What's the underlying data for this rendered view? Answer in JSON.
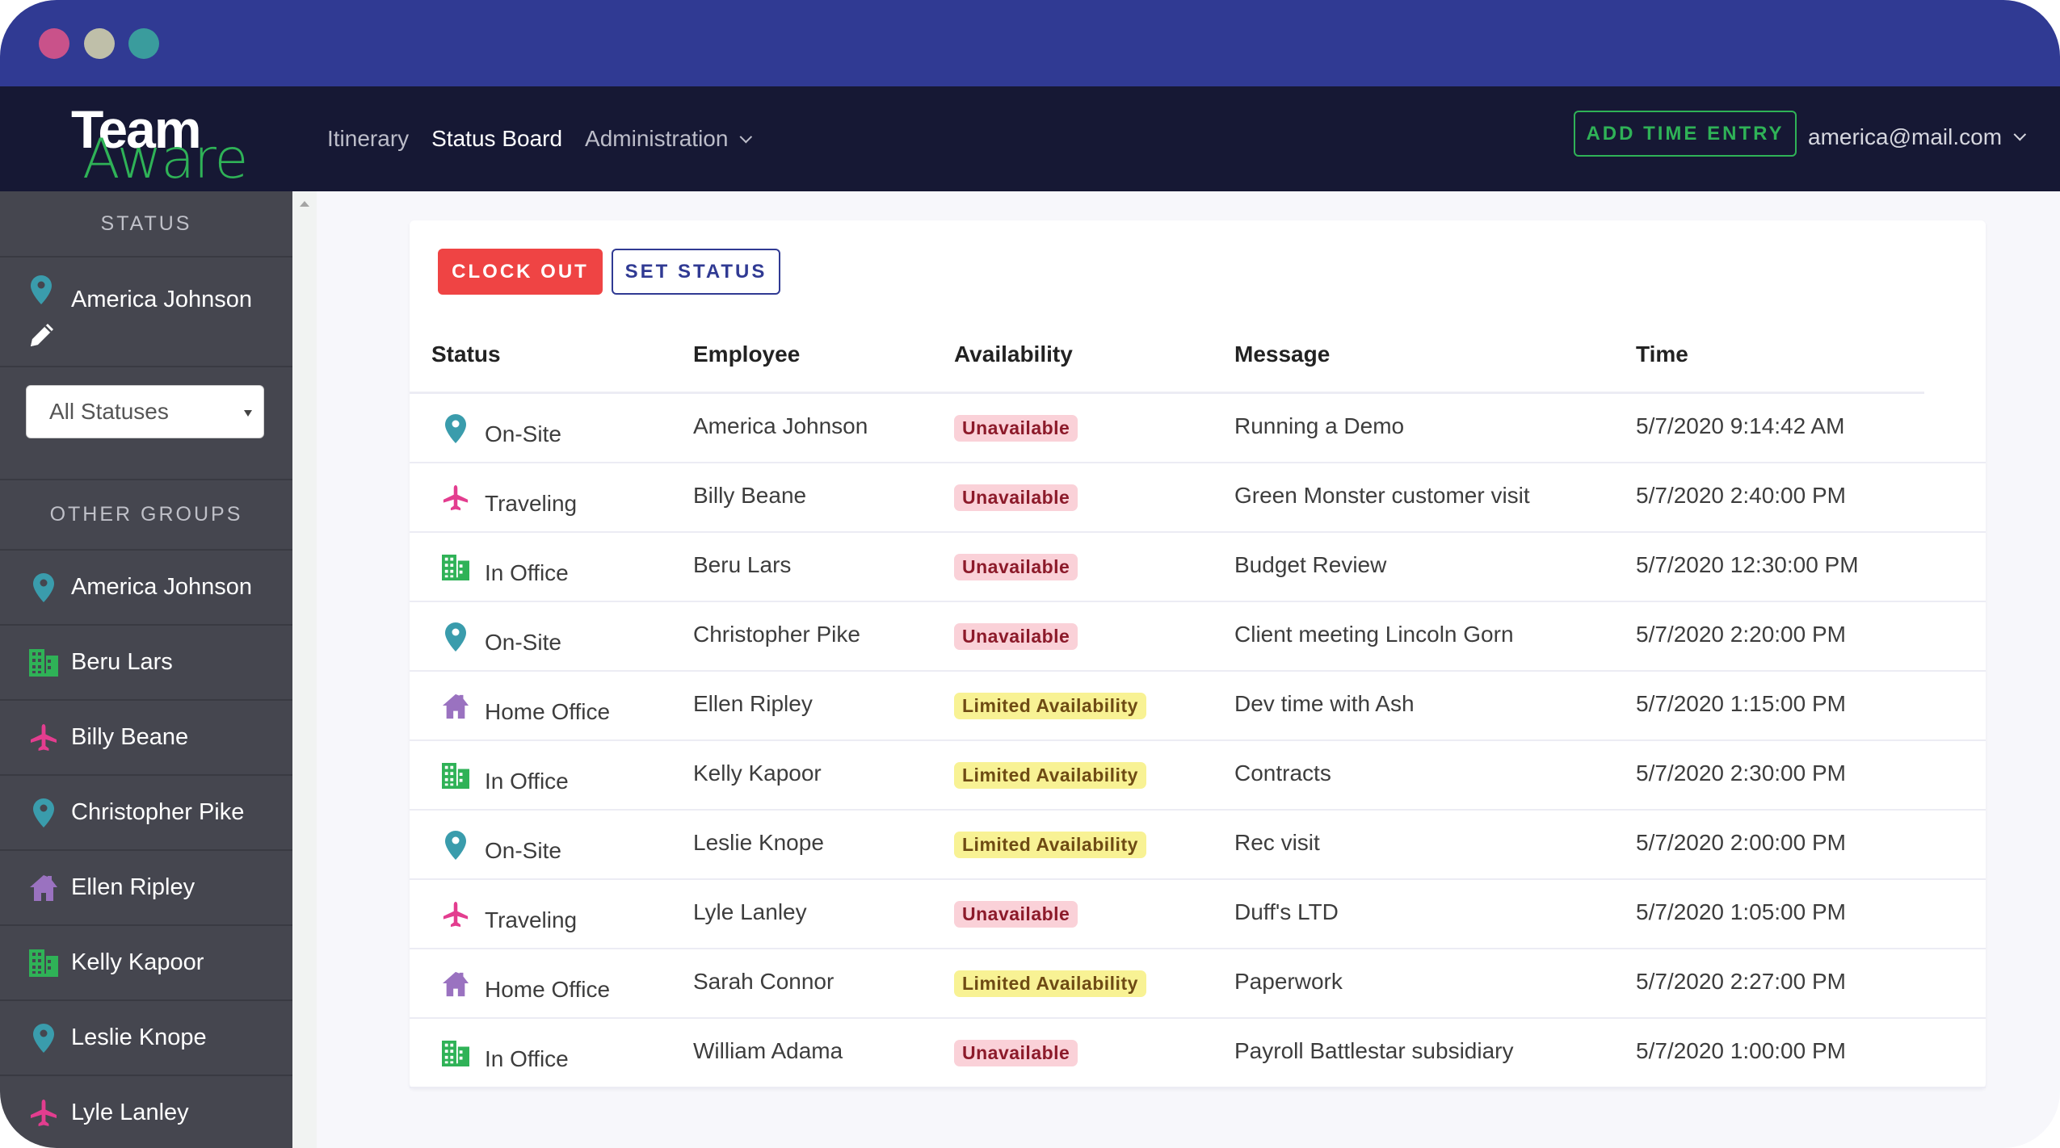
{
  "window": {
    "controls": [
      "close",
      "minimize",
      "maximize"
    ]
  },
  "brand": {
    "line1": "Team",
    "line2": "Aware"
  },
  "nav": {
    "links": [
      {
        "label": "Itinerary",
        "active": false
      },
      {
        "label": "Status Board",
        "active": true
      },
      {
        "label": "Administration",
        "active": false,
        "dropdown": true
      }
    ],
    "add_time_entry_label": "ADD TIME ENTRY",
    "user_email": "america@mail.com"
  },
  "sidebar": {
    "status_heading": "STATUS",
    "current_user": {
      "name": "America Johnson",
      "status_icon": "map-pin-icon",
      "edit_icon": "pencil-icon"
    },
    "filter": {
      "selected": "All Statuses"
    },
    "other_groups_heading": "OTHER GROUPS",
    "members": [
      {
        "name": "America Johnson",
        "status": "On-Site"
      },
      {
        "name": "Beru Lars",
        "status": "In Office"
      },
      {
        "name": "Billy Beane",
        "status": "Traveling"
      },
      {
        "name": "Christopher Pike",
        "status": "On-Site"
      },
      {
        "name": "Ellen Ripley",
        "status": "Home Office"
      },
      {
        "name": "Kelly Kapoor",
        "status": "In Office"
      },
      {
        "name": "Leslie Knope",
        "status": "On-Site"
      },
      {
        "name": "Lyle Lanley",
        "status": "Traveling"
      }
    ]
  },
  "status_types": {
    "On-Site": {
      "icon": "map-pin-icon",
      "color": "#3a9cac"
    },
    "Traveling": {
      "icon": "airplane-icon",
      "color": "#e33d8f"
    },
    "In Office": {
      "icon": "building-icon",
      "color": "#2fb257"
    },
    "Home Office": {
      "icon": "home-icon",
      "color": "#9a72c0"
    }
  },
  "actions": {
    "clock_out_label": "CLOCK OUT",
    "set_status_label": "SET STATUS"
  },
  "table": {
    "columns": [
      "Status",
      "Employee",
      "Availability",
      "Message",
      "Time"
    ],
    "rows": [
      {
        "status": "On-Site",
        "employee": "America Johnson",
        "availability": "Unavailable",
        "message": "Running a Demo",
        "time": "5/7/2020 9:14:42 AM"
      },
      {
        "status": "Traveling",
        "employee": "Billy Beane",
        "availability": "Unavailable",
        "message": "Green Monster customer visit",
        "time": "5/7/2020 2:40:00 PM"
      },
      {
        "status": "In Office",
        "employee": "Beru Lars",
        "availability": "Unavailable",
        "message": "Budget Review",
        "time": "5/7/2020 12:30:00 PM"
      },
      {
        "status": "On-Site",
        "employee": "Christopher Pike",
        "availability": "Unavailable",
        "message": "Client meeting Lincoln Gorn",
        "time": "5/7/2020 2:20:00 PM"
      },
      {
        "status": "Home Office",
        "employee": "Ellen Ripley",
        "availability": "Limited Availability",
        "message": "Dev time with Ash",
        "time": "5/7/2020 1:15:00 PM"
      },
      {
        "status": "In Office",
        "employee": "Kelly Kapoor",
        "availability": "Limited Availability",
        "message": "Contracts",
        "time": "5/7/2020 2:30:00 PM"
      },
      {
        "status": "On-Site",
        "employee": "Leslie Knope",
        "availability": "Limited Availability",
        "message": "Rec visit",
        "time": "5/7/2020 2:00:00 PM"
      },
      {
        "status": "Traveling",
        "employee": "Lyle Lanley",
        "availability": "Unavailable",
        "message": "Duff's LTD",
        "time": "5/7/2020 1:05:00 PM"
      },
      {
        "status": "Home Office",
        "employee": "Sarah Connor",
        "availability": "Limited Availability",
        "message": "Paperwork",
        "time": "5/7/2020 2:27:00 PM"
      },
      {
        "status": "In Office",
        "employee": "William Adama",
        "availability": "Unavailable",
        "message": "Payroll Battlestar subsidiary",
        "time": "5/7/2020 1:00:00 PM"
      }
    ]
  },
  "colors": {
    "titlebar": "#303a93",
    "navbar": "#161834",
    "sidebar": "#45464f",
    "accent_green": "#2fb257",
    "clock_out_red": "#ef4444",
    "set_status_blue": "#303a93",
    "unavailable_bg": "#fad1d8",
    "limited_bg": "#f8f294"
  }
}
